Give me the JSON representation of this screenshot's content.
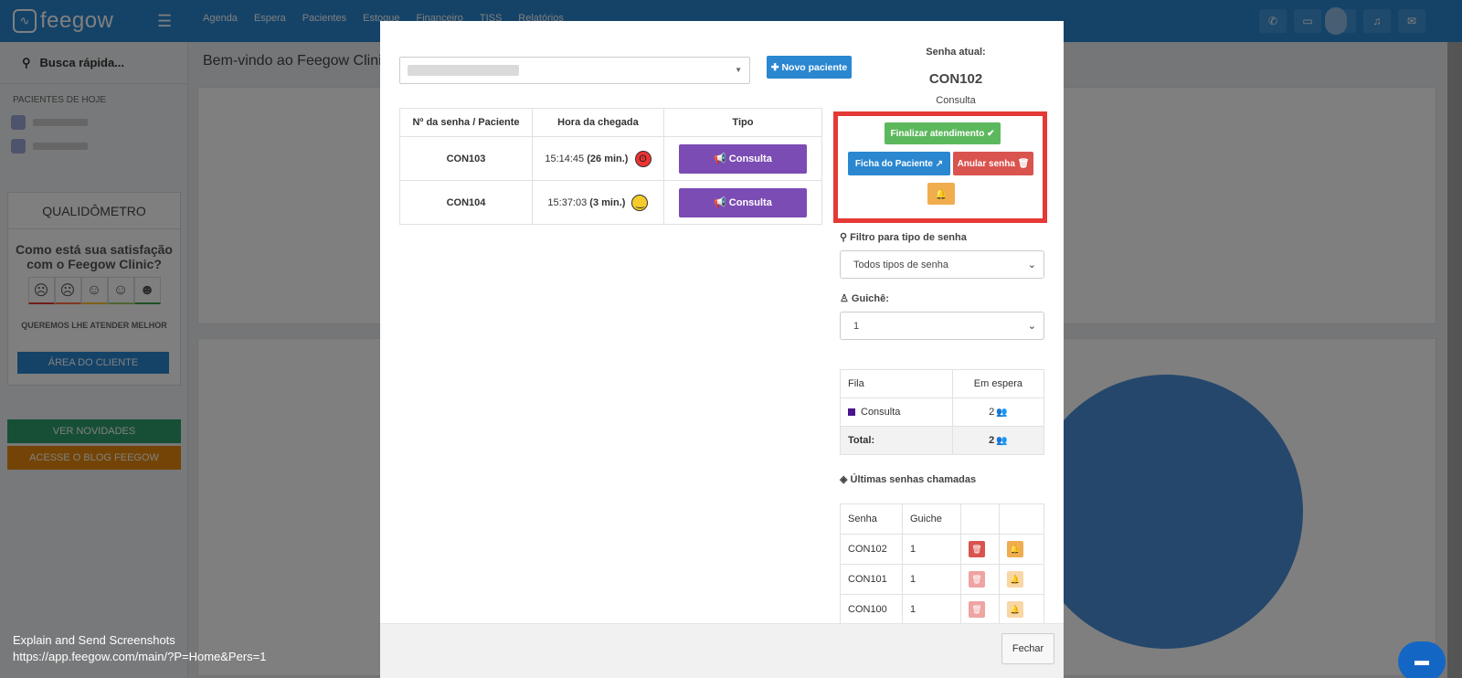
{
  "app": {
    "logo_text": "feegow",
    "nav_items": [
      "Agenda",
      "Espera",
      "Pacientes",
      "Estoque",
      "Financeiro",
      "TISS",
      "Relatórios"
    ],
    "quick_search": "Busca rápida...",
    "pacientes_hoje": "PACIENTES DE HOJE",
    "welcome": "Bem-vindo ao Feegow Clinic",
    "qualidometro": {
      "title": "QUALIDÔMETRO",
      "question": "Como está sua satisfação com o Feegow Clinic?",
      "subtitle": "QUEREMOS LHE ATENDER MELHOR",
      "button": "ÁREA DO CLIENTE"
    },
    "ver_novidades": "VER NOVIDADES",
    "acesse_blog": "ACESSE O BLOG FEEGOW",
    "colors": {
      "primary": "#2a87d0",
      "novidades": "#2e9e6d",
      "blog": "#e8890c"
    }
  },
  "modal": {
    "novo_paciente": "Novo paciente",
    "queue_headers": [
      "Nº da senha / Paciente",
      "Hora da chegada",
      "Tipo"
    ],
    "queue_rows": [
      {
        "senha": "CON103",
        "hora": "15:14:45",
        "espera": "(26 min.)",
        "mood": "angry",
        "tipo": "Consulta"
      },
      {
        "senha": "CON104",
        "hora": "15:37:03",
        "espera": "(3 min.)",
        "mood": "happy",
        "tipo": "Consulta"
      }
    ],
    "senha_atual_label": "Senha atual:",
    "senha_atual": "CON102",
    "senha_tipo": "Consulta",
    "actions": {
      "finalizar": "Finalizar atendimento",
      "ficha": "Ficha do Paciente",
      "anular": "Anular senha"
    },
    "filtro_label": "Filtro para tipo de senha",
    "filtro_value": "Todos tipos de senha",
    "guiche_label": "Guichê:",
    "guiche_value": "1",
    "fila": {
      "headers": [
        "Fila",
        "Em espera"
      ],
      "row": {
        "name": "Consulta",
        "count": "2"
      },
      "total_label": "Total:",
      "total": "2"
    },
    "ultimas_label": "Últimas senhas chamadas",
    "ultimas_headers": [
      "Senha",
      "Guiche"
    ],
    "ultimas_rows": [
      {
        "senha": "CON102",
        "guiche": "1"
      },
      {
        "senha": "CON101",
        "guiche": "1"
      },
      {
        "senha": "CON100",
        "guiche": "1"
      }
    ],
    "fechar": "Fechar"
  },
  "overlay_note": {
    "line1": "Explain and Send Screenshots",
    "line2": "https://app.feegow.com/main/?P=Home&Pers=1"
  }
}
